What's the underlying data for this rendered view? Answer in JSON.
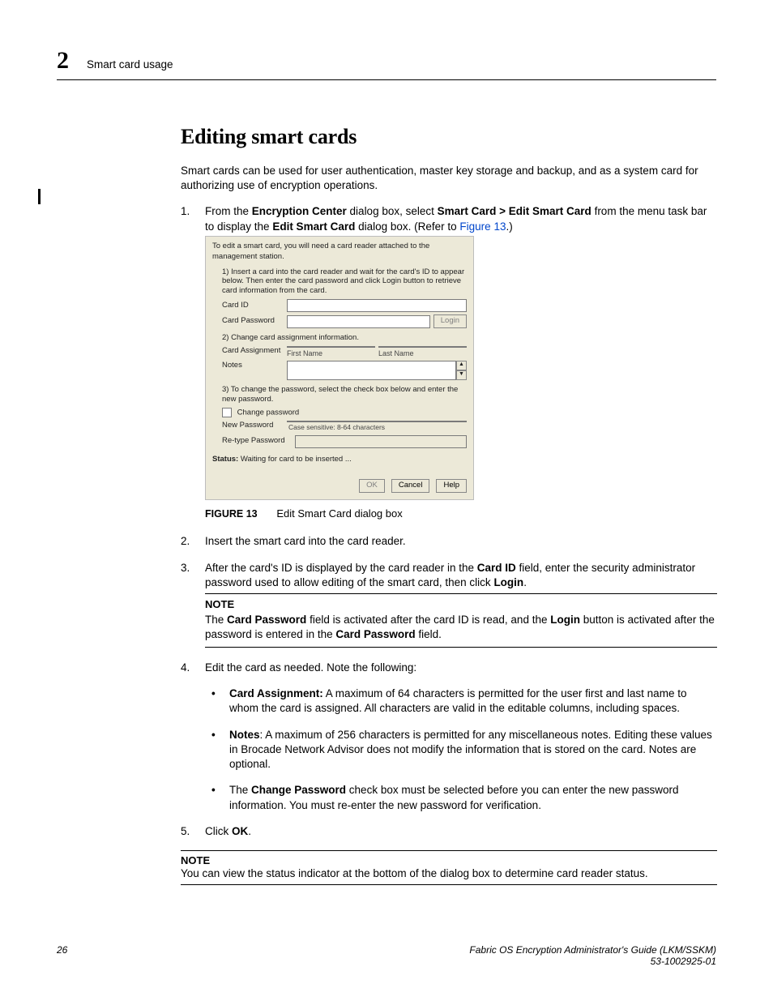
{
  "header": {
    "chapter_num": "2",
    "running_title": "Smart card usage"
  },
  "section_title": "Editing smart cards",
  "intro": "Smart cards can be used for user authentication, master key storage and backup, and as a system card for authorizing use of encryption operations.",
  "step1": {
    "pre": "From the ",
    "b1": "Encryption Center",
    "mid1": " dialog box, select ",
    "b2": "Smart Card > Edit Smart Card",
    "mid2": " from the menu task bar to display the ",
    "b3": "Edit Smart Card",
    "mid3": " dialog box. (Refer to ",
    "link": "Figure 13",
    "post": ".)"
  },
  "dialog": {
    "top": "To edit a smart card, you will need a card reader attached to the management station.",
    "instr1": "1) Insert a card into the card reader and wait for the card's ID to appear below. Then enter the card password and click Login button to retrieve card information from the card.",
    "card_id_label": "Card ID",
    "card_pw_label": "Card Password",
    "login_btn": "Login",
    "instr2": "2) Change card assignment information.",
    "assign_label": "Card Assignment",
    "first_name": "First Name",
    "last_name": "Last Name",
    "notes_label": "Notes",
    "instr3": "3) To change the password, select the check box below and enter the new password.",
    "change_pw": "Change password",
    "new_pw": "New Password",
    "pw_hint": "Case sensitive: 8-64 characters",
    "retype_pw": "Re-type Password",
    "status_label": "Status:",
    "status_text": " Waiting for card to be inserted ...",
    "ok": "OK",
    "cancel": "Cancel",
    "help": "Help"
  },
  "figure": {
    "label": "FIGURE 13",
    "caption": "Edit Smart Card dialog box"
  },
  "step2": "Insert the smart card into the card reader.",
  "step3": {
    "pre": "After the card's ID is displayed by the card reader in the ",
    "b1": "Card ID",
    "mid": " field, enter the security administrator password used to allow editing of the smart card, then click ",
    "b2": "Login",
    "post": "."
  },
  "note1": {
    "label": "NOTE",
    "t1": "The ",
    "b1": "Card Password",
    "t2": " field is activated after the card ID is read, and the ",
    "b2": "Login",
    "t3": " button is activated after the password is entered in the ",
    "b3": "Card Password",
    "t4": " field."
  },
  "step4": {
    "lead": "Edit the card as needed. Note the following:",
    "bullet1": {
      "b": "Card Assignment:",
      "t": " A maximum of 64 characters is permitted for the user first and last name to whom the card is assigned. All characters are valid in the editable columns, including spaces."
    },
    "bullet2": {
      "b": "Notes",
      "t": ": A maximum of 256 characters is permitted for any miscellaneous notes. Editing these values in Brocade Network Advisor does not modify the information that is stored on the card. Notes are optional."
    },
    "bullet3": {
      "t1": "The ",
      "b": "Change Password",
      "t2": " check box must be selected before you can enter the new password information. You must re-enter the new password for verification."
    }
  },
  "step5": {
    "t1": "Click ",
    "b": "OK",
    "t2": "."
  },
  "note2": {
    "label": "NOTE",
    "text": "You can view the status indicator at the bottom of the dialog box to determine card reader status."
  },
  "footer": {
    "page_num": "26",
    "doc_title": "Fabric OS Encryption Administrator's Guide  (LKM/SSKM)",
    "doc_id": "53-1002925-01"
  }
}
